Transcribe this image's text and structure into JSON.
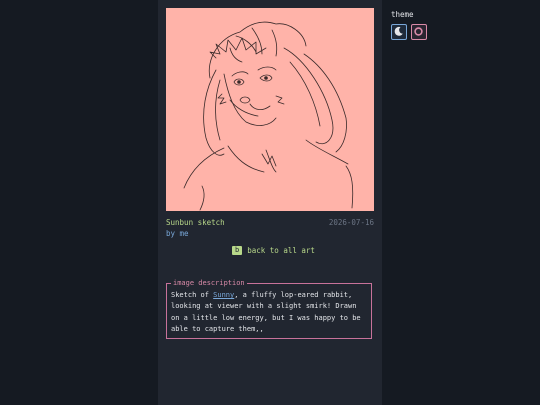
{
  "artwork": {
    "title": "Sunbun sketch",
    "date": "2026-07-16",
    "byline": "by me",
    "background_color": "#ffb3a9"
  },
  "nav": {
    "back_key": "b",
    "back_label": "back to all art"
  },
  "description": {
    "legend": "image description",
    "text_before": "Sketch of ",
    "link_text": "Sunny",
    "text_after": ", a fluffy lop-eared rabbit, looking at viewer with a slight smirk! Drawn on a little low energy, but I was happy to be able to capture them,,"
  },
  "theme": {
    "label": "theme",
    "options": [
      {
        "name": "dark",
        "icon": "moon-icon",
        "color": "#79a7d8"
      },
      {
        "name": "pink",
        "icon": "blob-icon",
        "color": "#d98aa8"
      }
    ]
  },
  "colors": {
    "page_bg": "#151a22",
    "column_bg": "#212630",
    "accent_green": "#b8d88a",
    "accent_blue": "#79a7d8",
    "accent_pink": "#c8729a",
    "muted": "#6c7585"
  }
}
